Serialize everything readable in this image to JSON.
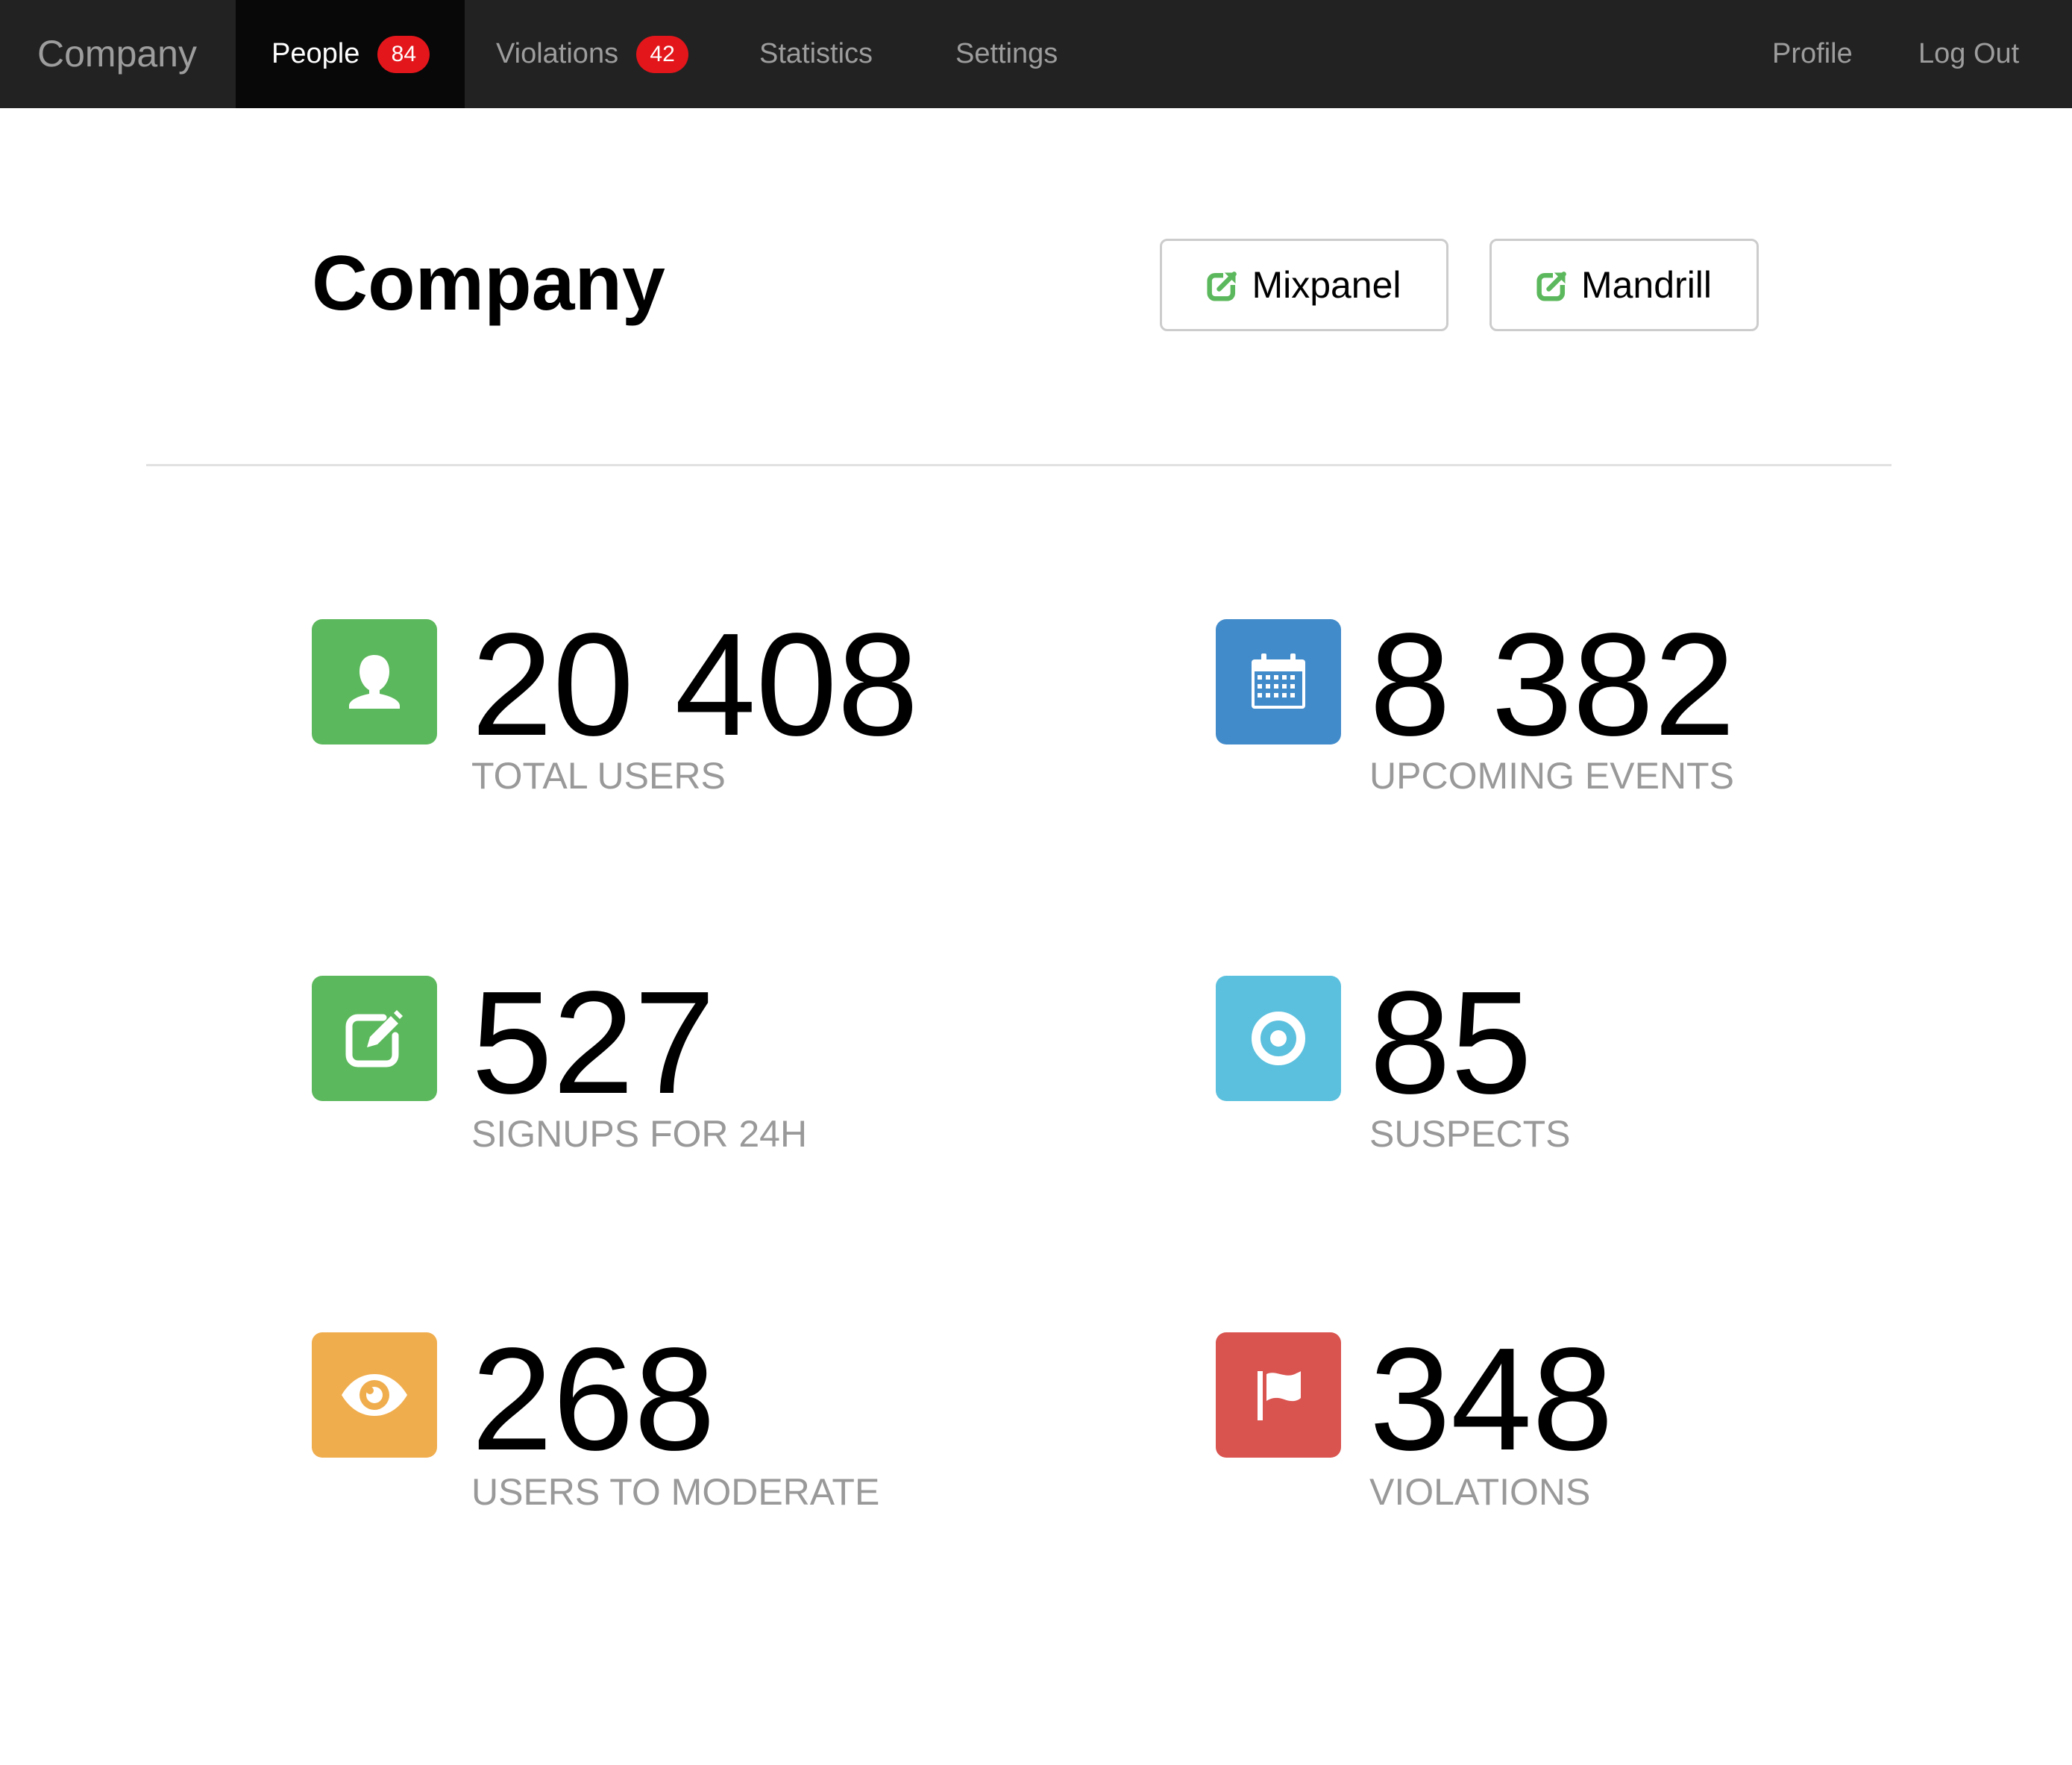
{
  "navbar": {
    "brand": "Company",
    "items": [
      {
        "label": "People",
        "badge": "84",
        "active": true
      },
      {
        "label": "Violations",
        "badge": "42",
        "active": false
      },
      {
        "label": "Statistics"
      },
      {
        "label": "Settings"
      }
    ],
    "right_items": [
      {
        "label": "Profile"
      },
      {
        "label": "Log Out"
      }
    ],
    "badge_color": "#e3161b",
    "background": "#222222"
  },
  "header": {
    "title": "Company",
    "buttons": [
      {
        "label": "Mixpanel",
        "icon": "external-link-icon"
      },
      {
        "label": "Mandrill",
        "icon": "external-link-icon"
      }
    ]
  },
  "stats": [
    {
      "value": "20 408",
      "label": "TOTAL USERS",
      "icon": "user-icon",
      "color": "#5cb85c"
    },
    {
      "value": "8 382",
      "label": "UPCOMING EVENTS",
      "icon": "calendar-icon",
      "color": "#428bca"
    },
    {
      "value": "527",
      "label": "SIGNUPS FOR 24H",
      "icon": "edit-icon",
      "color": "#5cb85c"
    },
    {
      "value": "85",
      "label": "SUSPECTS",
      "icon": "target-icon",
      "color": "#5bc0de"
    },
    {
      "value": "268",
      "label": "USERS TO MODERATE",
      "icon": "eye-icon",
      "color": "#f0ad4e"
    },
    {
      "value": "348",
      "label": "VIOLATIONS",
      "icon": "flag-icon",
      "color": "#d9534f"
    }
  ]
}
